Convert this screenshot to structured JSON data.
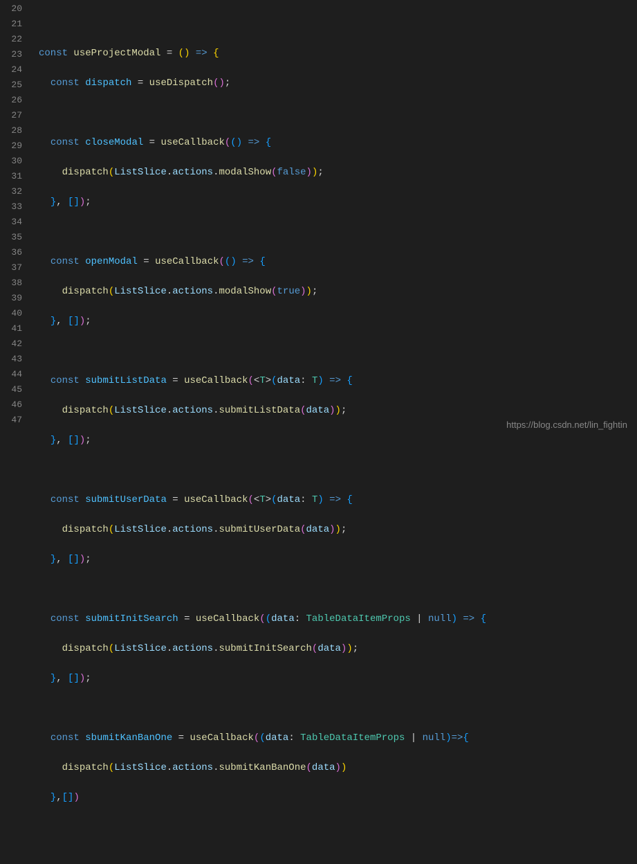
{
  "watermark": "https://blog.csdn.net/lin_fightin",
  "line_numbers": [
    "20",
    "21",
    "22",
    "23",
    "24",
    "25",
    "26",
    "27",
    "28",
    "29",
    "30",
    "31",
    "32",
    "33",
    "34",
    "35",
    "36",
    "37",
    "38",
    "39",
    "40",
    "41",
    "42",
    "43",
    "44",
    "45",
    "46",
    "47"
  ],
  "code_tokens": {
    "const": "const",
    "useProjectModal": "useProjectModal",
    "dispatch": "dispatch",
    "useDispatch": "useDispatch",
    "closeModal": "closeModal",
    "useCallback": "useCallback",
    "ListSlice": "ListSlice",
    "actions": "actions",
    "modalShow": "modalShow",
    "false": "false",
    "true": "true",
    "openModal": "openModal",
    "submitListData": "submitListData",
    "submitUserData": "submitUserData",
    "submitInitSearch": "submitInitSearch",
    "sbumitKanBanOne": "sbumitKanBanOne",
    "submitKanBanOne": "submitKanBanOne",
    "data": "data",
    "T": "T",
    "TableDataItemProps": "TableDataItemProps",
    "null": "null",
    "arrow": "=>",
    "dot": ".",
    "semi": ";",
    "comma": ",",
    "pipe": "|",
    "colon": ":",
    "eq": "=",
    "lbrace": "{",
    "rbrace": "}",
    "lparen": "(",
    "rparen": ")",
    "lbracket": "[",
    "rbracket": "]",
    "lt": "<",
    "gt": ">"
  }
}
